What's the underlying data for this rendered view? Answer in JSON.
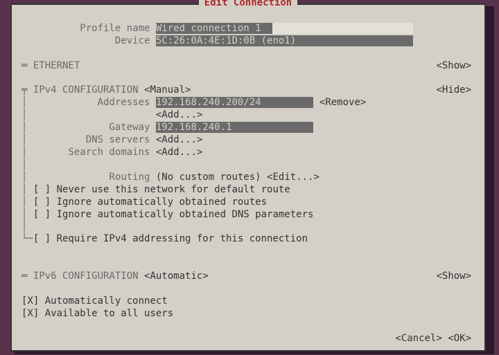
{
  "title": " Edit Connection ",
  "labels": {
    "profile": "          Profile name",
    "device": "                Device",
    "ethernet": "═ ETHERNET",
    "ipv4": "  IPv4 CONFIGURATION",
    "addresses": "             Addresses",
    "gateway": "               Gateway",
    "dns": "           DNS servers",
    "search": "        Search domains",
    "routing": "               Routing",
    "ipv6": "═ IPv6 CONFIGURATION",
    "chk_never": "  [ ] Never use this network for default route",
    "chk_ign_routes": "  [ ] Ignore automatically obtained routes",
    "chk_ign_dns": "  [ ] Ignore automatically obtained DNS parameters",
    "chk_require": "  [ ] Require IPv4 addressing for this connection",
    "chk_auto": "[X] Automatically connect",
    "chk_allusers": "[X] Available to all users"
  },
  "fields": {
    "profile": "Wired connection 1",
    "device": "5C:26:0A:4E:1D:0B (eno1)",
    "ipv4_mode": "<Manual>",
    "address": "192.168.240.200/24",
    "gateway": "192.168.240.1",
    "no_routes": "(No custom routes)",
    "ipv6_mode": "<Automatic>"
  },
  "actions": {
    "show": "<Show>",
    "hide": "<Hide>",
    "remove": "<Remove>",
    "add": "<Add...>",
    "edit": "<Edit...>",
    "cancel": "<Cancel>",
    "ok": "<OK>"
  },
  "widths": {
    "line": 77,
    "col_right": 71
  }
}
